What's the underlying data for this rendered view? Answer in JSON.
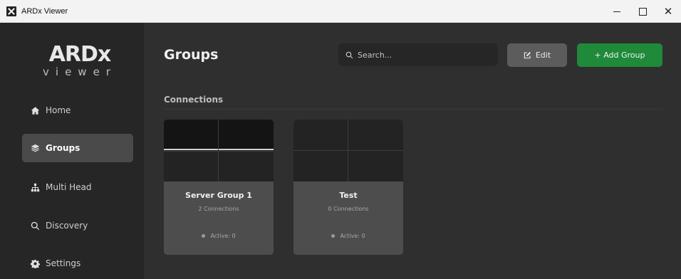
{
  "window": {
    "title": "ARDx Viewer",
    "controls": {
      "minimize": "",
      "maximize": "",
      "close": "✕"
    }
  },
  "sidebar": {
    "logo_main": "ARDx",
    "logo_sub": "viewer",
    "items": [
      {
        "label": "Home",
        "icon": "home-icon",
        "active": false
      },
      {
        "label": "Groups",
        "icon": "layers-icon",
        "active": true
      },
      {
        "label": "Multi Head",
        "icon": "sitemap-icon",
        "active": false
      },
      {
        "label": "Discovery",
        "icon": "search-icon",
        "active": false
      },
      {
        "label": "Settings",
        "icon": "gear-icon",
        "active": false
      }
    ]
  },
  "header": {
    "title": "Groups",
    "search_placeholder": "Search...",
    "edit_label": "Edit",
    "add_label": "+ Add Group"
  },
  "section": {
    "title": "Connections"
  },
  "groups": [
    {
      "name": "Server Group 1",
      "connections": "2 Connections",
      "active": "Active: 0"
    },
    {
      "name": "Test",
      "connections": "0 Connections",
      "active": "Active: 0"
    }
  ],
  "colors": {
    "accent_green": "#1e8a3a",
    "sidebar_bg": "#262626",
    "main_bg": "#2f2f2f",
    "card_bg": "#4d4d4d"
  }
}
